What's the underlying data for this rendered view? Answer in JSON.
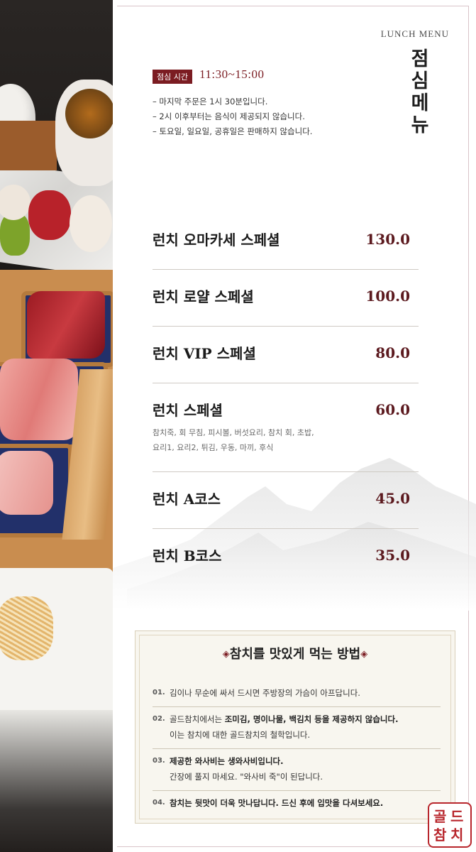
{
  "header": {
    "subtitle_en": "LUNCH MENU",
    "title_chars": [
      "점",
      "심",
      "메",
      "뉴"
    ]
  },
  "hours": {
    "badge": "점심 시간",
    "time": "11:30~15:00",
    "notes": [
      "– 마지막 주문은 1시 30분입니다.",
      "– 2시 이후부터는 음식이 제공되지 않습니다.",
      "– 토요일, 일요일, 공휴일은 판매하지 않습니다."
    ]
  },
  "menu": [
    {
      "name": "런치 오마카세 스페셜",
      "price": "130.0"
    },
    {
      "name": "런치 로얄 스페셜",
      "price": "100.0"
    },
    {
      "name": "런치 VIP 스페셜",
      "price": "80.0"
    },
    {
      "name": "런치 스페셜",
      "price": "60.0",
      "desc_lines": [
        "참치죽, 회 무침, 피시볼, 버섯요리, 참치 회, 초밥,",
        "요리1, 요리2, 튀김, 우동, 마끼, 후식"
      ]
    },
    {
      "name": "런치 A코스",
      "price": "45.0"
    },
    {
      "name": "런치 B코스",
      "price": "35.0"
    }
  ],
  "tips": {
    "title": "참치를 맛있게 먹는 방법",
    "ornament_left": "◈",
    "ornament_right": "◈",
    "items": [
      {
        "num": "01.",
        "lines": [
          [
            "",
            "김이나 무순에 싸서 드시면 주방장의 가슴이 아프답니다."
          ]
        ]
      },
      {
        "num": "02.",
        "lines": [
          [
            "골드참치에서는 ",
            "조미김, 명이나물, 백김치 등을 제공하지 않습니다."
          ],
          [
            "이는 참치에 대한 골드참치의 철학입니다.",
            ""
          ]
        ]
      },
      {
        "num": "03.",
        "lines": [
          [
            "",
            "제공한 와사비는 생와사비입니다."
          ],
          [
            "간장에 풀지 마세요. \"와사비 죽\"이 된답니다.",
            ""
          ]
        ]
      },
      {
        "num": "04.",
        "lines": [
          [
            "",
            "참치는 뒷맛이 더욱 맛나답니다. 드신 후에 입맛을 다셔보세요."
          ]
        ]
      }
    ]
  },
  "stamp": {
    "chars": [
      "골",
      "드",
      "참",
      "치"
    ]
  },
  "colors": {
    "accent": "#7b1c22",
    "price": "#5c1a1f"
  }
}
